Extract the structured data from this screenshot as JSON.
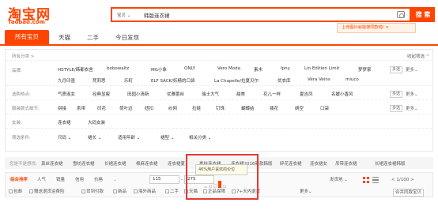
{
  "logo": {
    "cn": "淘宝网",
    "en": "Taobao.com"
  },
  "search": {
    "scope": "宝贝 ⌄",
    "query": "韩版连衣裙",
    "button": "搜 索"
  },
  "promo_tip": "上传图片就能搜同款啦! ×",
  "tabs": [
    "所有宝贝",
    "天猫",
    "二手",
    "今日发现"
  ],
  "filters": {
    "crumb": "所有分类 >",
    "collapse": "收起筛选 ^",
    "brand_label": "品牌:",
    "brands_row1": [
      "HSTYLE/韩都衣舍",
      "bobowaltz",
      "MG小象",
      "ONLY",
      "Vero Moda",
      "素木",
      "Ipny",
      "Lin Edition Limit",
      "梦梦家"
    ],
    "brands_row2": [
      "九月印墨",
      "梵莉思",
      "乐町",
      "ELF SACK/妖精的口袋",
      "La Chapelle/拉夏贝尔",
      "优衣库",
      "Vera Veins",
      "miuco"
    ],
    "hot_label": "选购热点:",
    "hot": [
      "气质淑女",
      "经典显瘦",
      "田园小清新",
      "优雅蕾丝",
      "瑞士大气",
      "甜美",
      "花儿一样",
      "夏吉凤",
      "名媛小香风"
    ],
    "detail_label": "服装款式细节:",
    "details": [
      "拼接",
      "系带",
      "印花",
      "荷叶边",
      "纽扣",
      "纱网",
      "拉链",
      "钉珠",
      "蝴蝶结",
      "镂花",
      "绣空",
      "口袋"
    ],
    "women_label": "女装:",
    "women": [
      "连衣裙",
      "大码女装"
    ],
    "cond_label": "筛选条件:",
    "conds": [
      "尺码 ⌄",
      "裙长 ⌄",
      "适用年龄 ⌄",
      "裙型 ⌄",
      "相关分类 ⌄"
    ],
    "multi": "多选",
    "more": "更多⌄"
  },
  "related": {
    "label": "您是不是想找:",
    "items": [
      "真丝连衣裙",
      "雪纺连衣裙",
      "长裙连衣裙",
      "棉麻连衣裙",
      "连衣裙夏",
      "裹挂连衣裙",
      "连衣裙2016新款韩版",
      "碎花连衣裙",
      "连衣裙女",
      "吊带连衣裙",
      "长裙连衣裙韩版"
    ]
  },
  "sort": {
    "items": [
      "综合排序",
      "人气",
      "销量",
      "信用",
      "价格"
    ],
    "price_from": "115",
    "price_to": "275",
    "price_sep": "-",
    "ship": "发货地 ⌄",
    "page": "< 1/100 >",
    "checks": [
      "包邮",
      "赠送退货运费险",
      "货到付款",
      "新品",
      "海外商品",
      "二手",
      "天猫",
      "正品保障",
      "7+天内退货"
    ],
    "more": "更多⌄",
    "merge": "合并同款宝贝"
  },
  "price_popup": "46%用户喜欢的价位",
  "price_bars": [
    0.2,
    0.35,
    0.5,
    0.9,
    0.4
  ],
  "colors": {
    "accent": "#ff4400",
    "highlight": "#e53935"
  }
}
